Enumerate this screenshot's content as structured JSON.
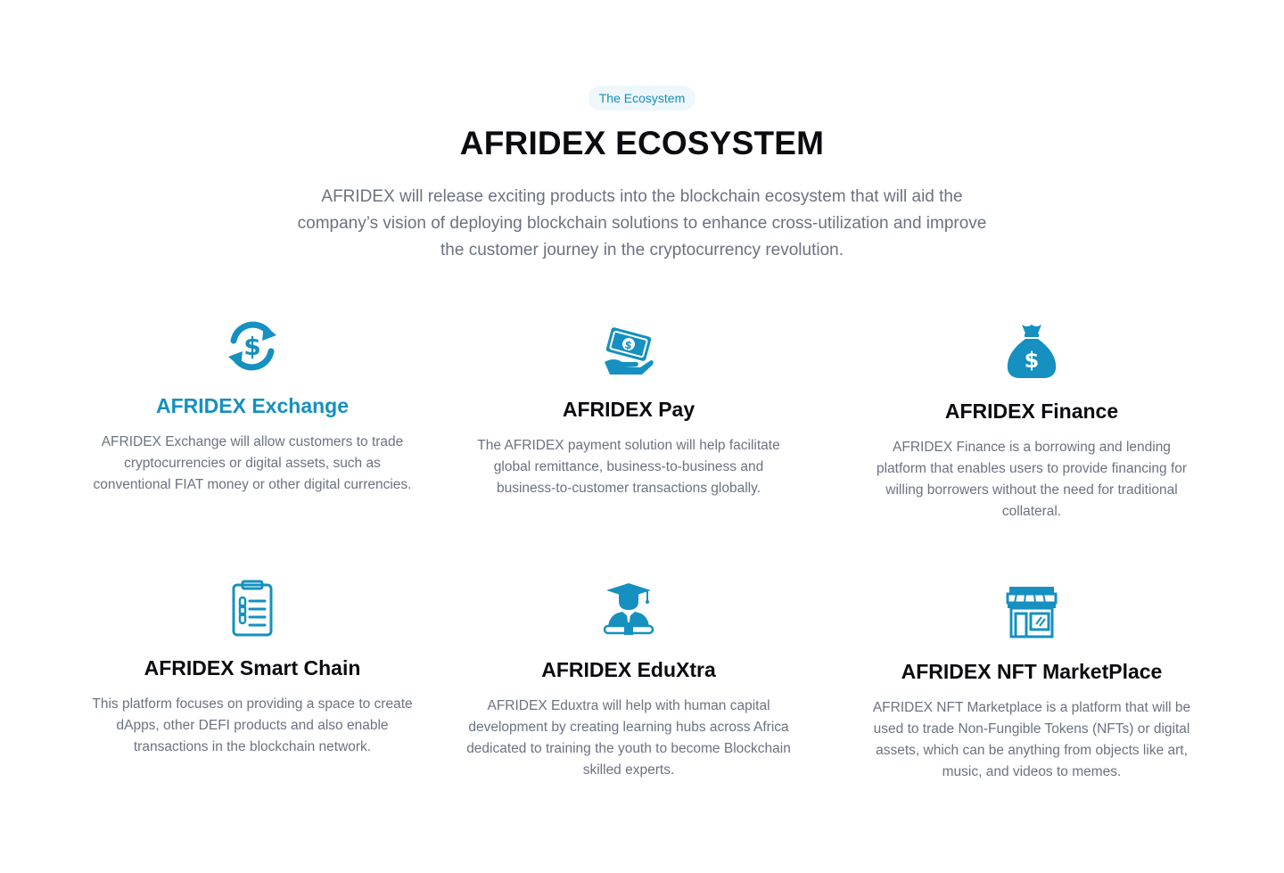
{
  "header": {
    "badge": "The Ecosystem",
    "title": "AFRIDEX ECOSYSTEM",
    "intro": "AFRIDEX will release exciting products into the blockchain ecosystem that will aid the company’s vision of deploying blockchain solutions to enhance cross-utilization and improve the customer journey in the cryptocurrency revolution."
  },
  "colors": {
    "accent": "#1590c0",
    "title": "#0b0b10",
    "text": "#6b7280",
    "badge_bg": "#eef7fb"
  },
  "products": [
    {
      "icon": "currency-exchange-icon",
      "title": "AFRIDEX Exchange",
      "description": "AFRIDEX Exchange will allow customers to trade cryptocurrencies or digital assets, such as conventional FIAT money or other digital currencies."
    },
    {
      "icon": "money-hand-icon",
      "title": "AFRIDEX Pay",
      "description": "The AFRIDEX payment solution will help facilitate global remittance, business-to-business and business-to-customer transactions globally."
    },
    {
      "icon": "money-bag-icon",
      "title": "AFRIDEX Finance",
      "description": "AFRIDEX Finance is a borrowing and lending platform that enables users to provide financing for willing borrowers without the need for traditional collateral."
    },
    {
      "icon": "clipboard-chain-icon",
      "title": "AFRIDEX Smart Chain",
      "description": "This platform focuses on providing a space to create dApps, other DEFI products and also enable transactions in the blockchain network."
    },
    {
      "icon": "graduate-icon",
      "title": "AFRIDEX EduXtra",
      "description": "AFRIDEX Eduxtra will help with human capital development by creating learning hubs across Africa dedicated to training the youth to become Blockchain skilled experts."
    },
    {
      "icon": "storefront-icon",
      "title": "AFRIDEX NFT MarketPlace",
      "description": "AFRIDEX NFT Marketplace is a platform that will be used to trade Non-Fungible Tokens (NFTs) or digital assets, which can be anything from objects like art, music, and videos to memes."
    }
  ]
}
